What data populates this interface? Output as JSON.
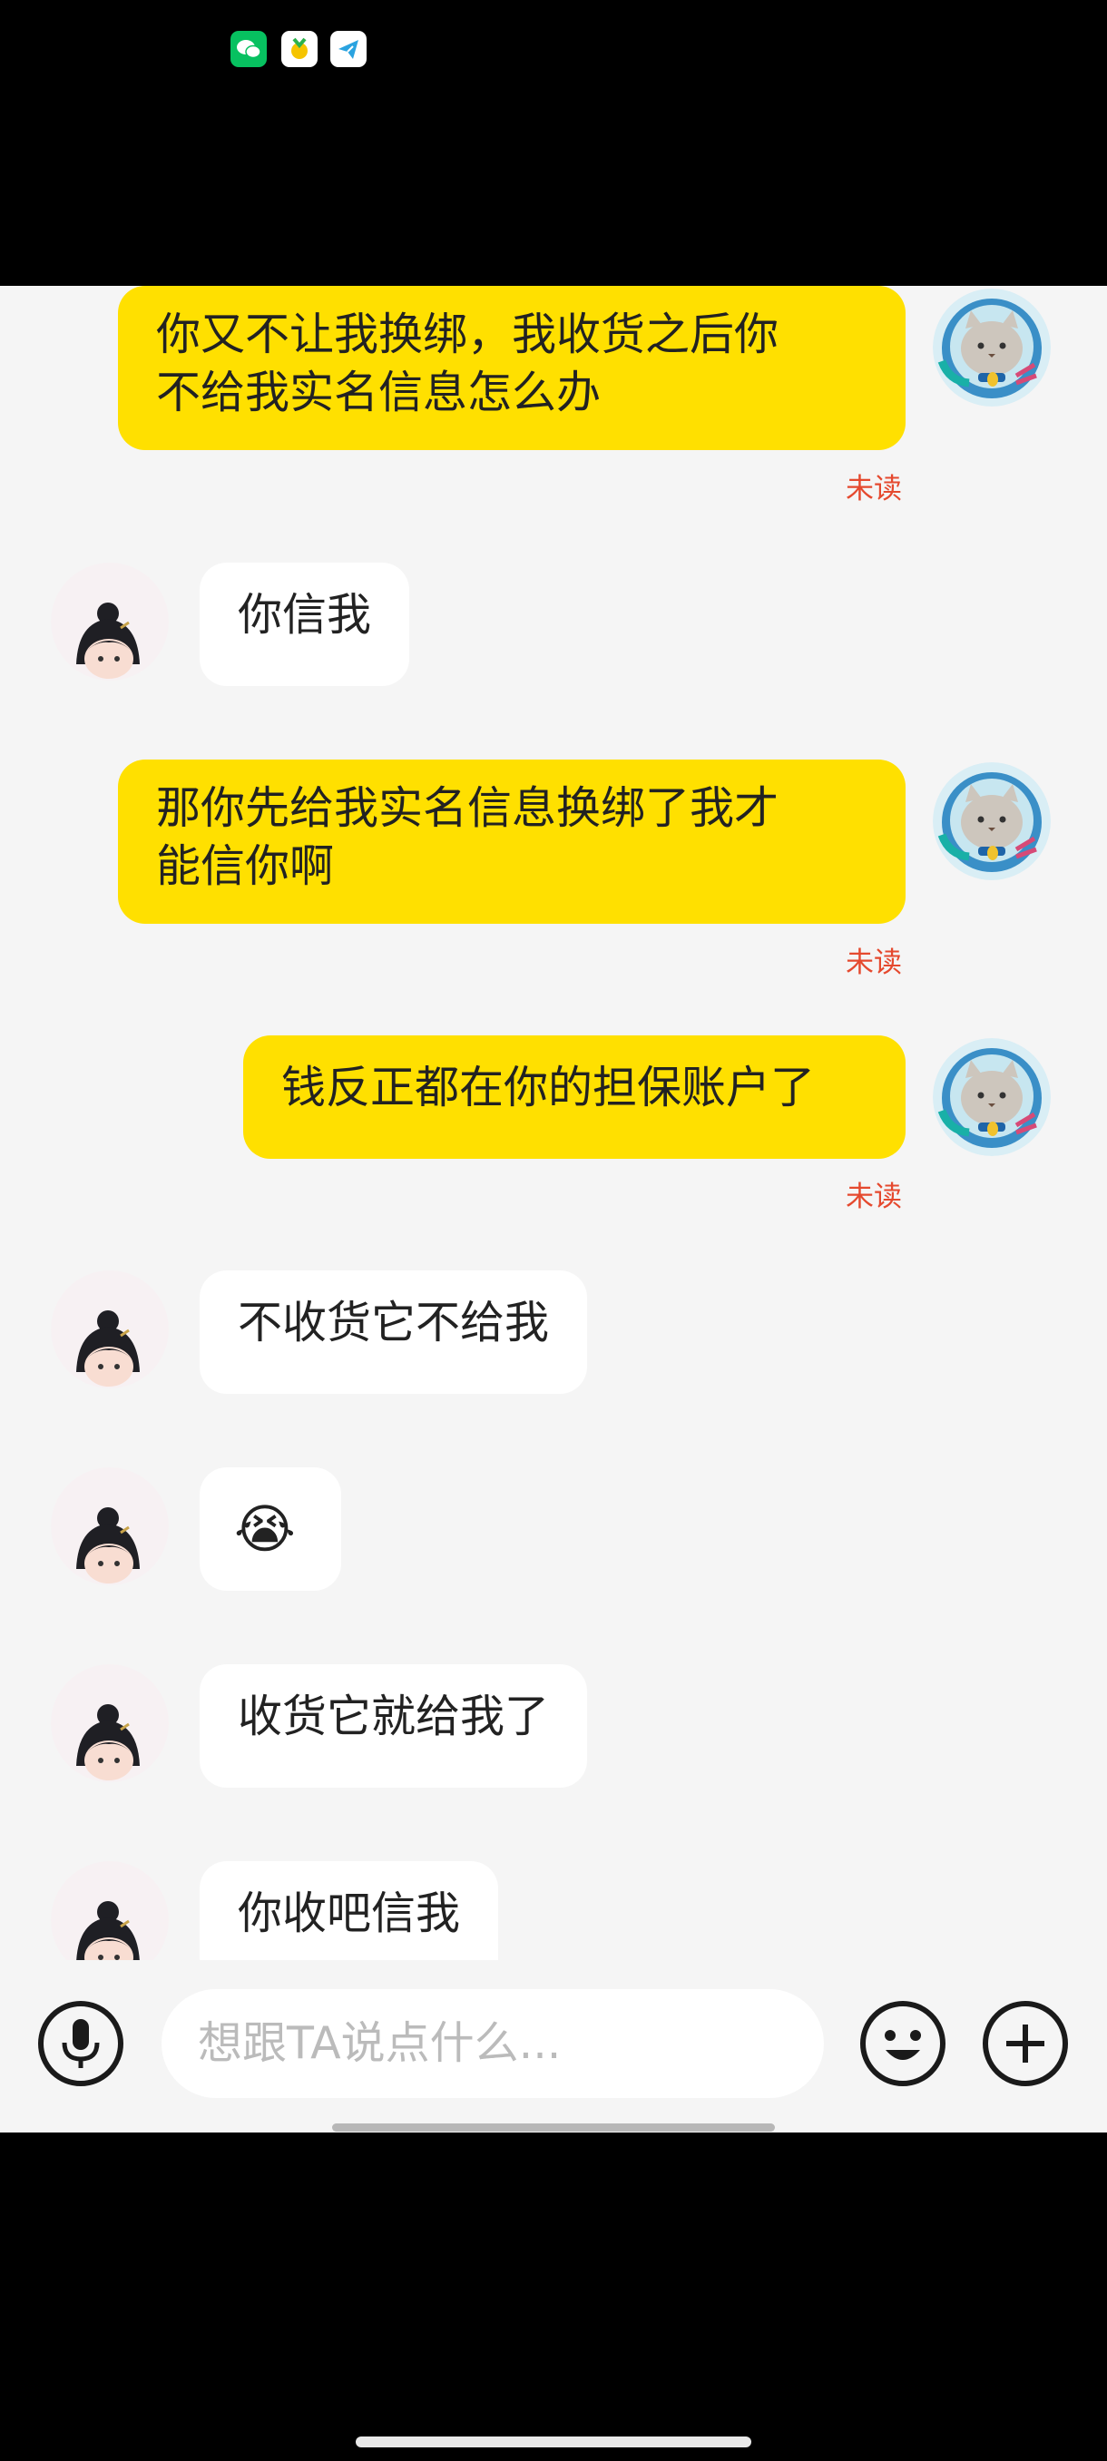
{
  "status_bar": {
    "icons": [
      "wechat-icon",
      "app-badge-icon",
      "telegram-icon"
    ]
  },
  "messages": [
    {
      "sender": "me",
      "lines": [
        "你又不让我换绑，我收货之后你",
        "不给我实名信息怎么办"
      ],
      "status": "未读"
    },
    {
      "sender": "other",
      "lines": [
        "你信我"
      ]
    },
    {
      "sender": "me",
      "lines": [
        "那你先给我实名信息换绑了我才",
        "能信你啊"
      ],
      "status": "未读"
    },
    {
      "sender": "me",
      "lines": [
        "钱反正都在你的担保账户了"
      ],
      "status": "未读"
    },
    {
      "sender": "other",
      "lines": [
        "不收货它不给我"
      ]
    },
    {
      "sender": "other",
      "lines": [
        "😭"
      ]
    },
    {
      "sender": "other",
      "lines": [
        "收货它就给我了"
      ]
    },
    {
      "sender": "other",
      "lines": [
        "你收吧信我"
      ]
    }
  ],
  "input_bar": {
    "placeholder": "想跟TA说点什么...",
    "icons": [
      "microphone-icon",
      "emoji-icon",
      "plus-icon"
    ]
  },
  "colors": {
    "my_bubble": "#ffe000",
    "other_bubble": "#ffffff",
    "chat_background": "#f5f5f5",
    "unread_text": "#e5492e"
  }
}
